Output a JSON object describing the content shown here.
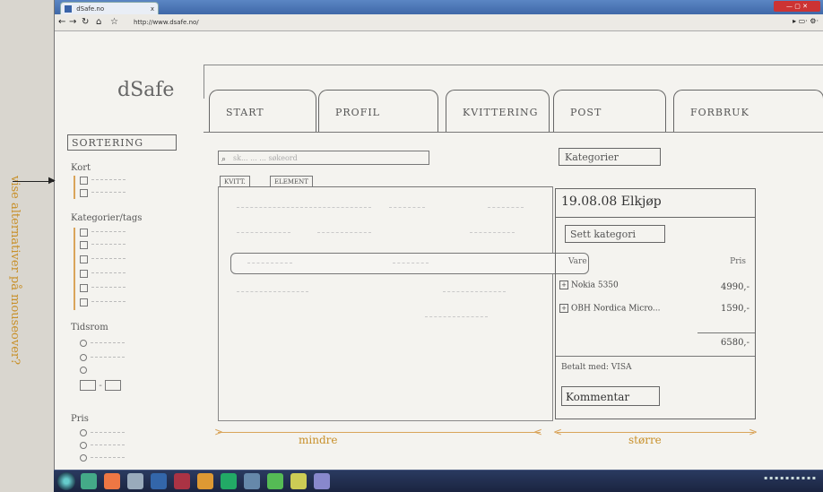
{
  "browser": {
    "tab_title": "dSafe.no",
    "url": "http://www.dsafe.no/",
    "tab_close": "x"
  },
  "app": {
    "logo": "dSafe",
    "tabs": [
      {
        "label": "START"
      },
      {
        "label": "PROFIL"
      },
      {
        "label": "KVITTERING"
      },
      {
        "label": "POST"
      },
      {
        "label": "FORBRUK"
      }
    ]
  },
  "sidebar": {
    "sort_button": "SORTERING",
    "kort_label": "Kort",
    "kategorier_label": "Kategorier/tags",
    "tidsrom_label": "Tidsrom",
    "pris_label": "Pris",
    "range_separator": "-"
  },
  "middle": {
    "search_placeholder": "sk... ... ... søkeord",
    "subtabs": [
      {
        "label": "KVITT."
      },
      {
        "label": "ELEMENT"
      }
    ]
  },
  "detail": {
    "kategorier_button": "Kategorier",
    "title": "19.08.08 Elkjøp",
    "sett_kategori_button": "Sett kategori",
    "col_vare": "Vare",
    "col_pris": "Pris",
    "items": [
      {
        "name": "Nokia 5350",
        "price": "4990,-"
      },
      {
        "name": "OBH Nordica Micro...",
        "price": "1590,-"
      }
    ],
    "total": "6580,-",
    "paid": "Betalt med: VISA",
    "kommentar_button": "Kommentar"
  },
  "annotations": {
    "side_note": "vise alternativer på mouseover?",
    "mindre": "mindre",
    "storre": "større"
  },
  "colors": {
    "sketch_line": "#666666",
    "annotation": "#c8902a"
  }
}
